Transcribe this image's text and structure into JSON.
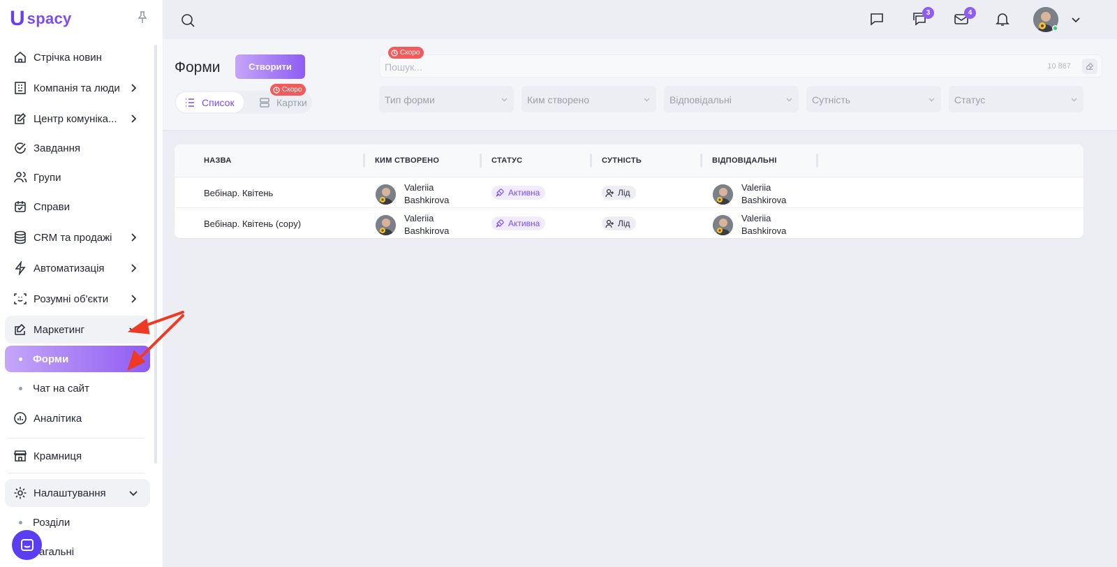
{
  "logo": {
    "mark": "U",
    "word": "spacy"
  },
  "sidebar": {
    "items": [
      {
        "label": "Стрічка новин",
        "icon": "home-icon",
        "chevron": false
      },
      {
        "label": "Компанія та люди",
        "icon": "building-icon",
        "chevron": true
      },
      {
        "label": "Центр комуніка...",
        "icon": "edit-note-icon",
        "chevron": true
      },
      {
        "label": "Завдання",
        "icon": "check-circle-icon",
        "chevron": false
      },
      {
        "label": "Групи",
        "icon": "users-icon",
        "chevron": false
      },
      {
        "label": "Справи",
        "icon": "calendar-check-icon",
        "chevron": false
      },
      {
        "label": "CRM та продажі",
        "icon": "database-icon",
        "chevron": true
      },
      {
        "label": "Автоматизація",
        "icon": "lightning-icon",
        "chevron": true
      },
      {
        "label": "Розумні об'єкти",
        "icon": "scan-face-icon",
        "chevron": true
      }
    ],
    "marketing": {
      "label": "Маркетинг",
      "icon": "megaphone-edit-icon"
    },
    "marketing_children": [
      {
        "label": "Форми",
        "active": true
      },
      {
        "label": "Чат на сайт",
        "active": false
      }
    ],
    "analytics": {
      "label": "Аналітика",
      "icon": "chart-circle-icon"
    },
    "store": {
      "label": "Крамниця",
      "icon": "store-icon"
    },
    "settings": {
      "label": "Налаштування",
      "icon": "gear-icon"
    },
    "settings_children": [
      {
        "label": "Розділи"
      },
      {
        "label": "Загальні"
      }
    ]
  },
  "topbar": {
    "chat_badge": "3",
    "mail_badge": "4"
  },
  "header": {
    "title": "Форми",
    "create_label": "Створити",
    "soon_label": "Скоро",
    "view_list": "Список",
    "view_cards": "Картки",
    "search_placeholder": "Пошук...",
    "search_count": "10 867",
    "filters": [
      "Тип форми",
      "Ким створено",
      "Відповідальні",
      "Сутність",
      "Статус"
    ]
  },
  "table": {
    "columns": [
      "НАЗВА",
      "КИМ СТВОРЕНО",
      "СТАТУС",
      "СУТНІСТЬ",
      "ВІДПОВІДАЛЬНІ"
    ],
    "rows": [
      {
        "name": "Вебінар. Квітень",
        "creator_first": "Valeriia",
        "creator_last": "Bashkirova",
        "status": "Активна",
        "entity": "Лід",
        "resp_first": "Valeriia",
        "resp_last": "Bashkirova"
      },
      {
        "name": "Вебінар. Квітень (copy)",
        "creator_first": "Valeriia",
        "creator_last": "Bashkirova",
        "status": "Активна",
        "entity": "Лід",
        "resp_first": "Valeriia",
        "resp_last": "Bashkirova"
      }
    ]
  },
  "colors": {
    "accent": "#8f5cf3",
    "accent_light": "#c5a6f8",
    "soon": "#f25b5b",
    "annotation": "#ee3a24"
  }
}
